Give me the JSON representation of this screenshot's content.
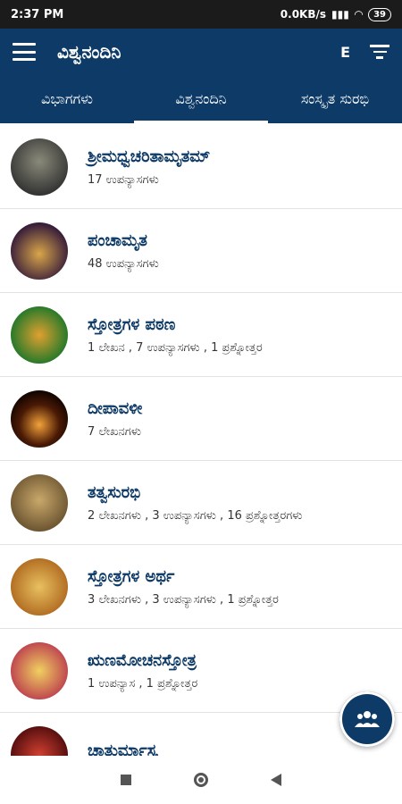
{
  "status": {
    "time": "2:37 PM",
    "speed": "0.0KB/s",
    "battery": "39"
  },
  "app": {
    "title": "ವಿಶ್ವನಂದಿನಿ",
    "lang": "E"
  },
  "tabs": [
    "ವಿಭಾಗಗಳು",
    "ವಿಶ್ವನಂದಿನಿ",
    "ಸಂಸ್ಕೃತ ಸುರಭಿ"
  ],
  "items": [
    {
      "title": "ಶ್ರೀಮಧ್ವಚರಿತಾಮೃತಮ್",
      "subtitle": "17 ಉಪನ್ಯಾಸಗಳು"
    },
    {
      "title": "ಪಂಚಾಮೃತ",
      "subtitle": "48 ಉಪನ್ಯಾಸಗಳು"
    },
    {
      "title": "ಸ್ತೋತ್ರಗಳ ಪಠಣ",
      "subtitle": "1 ಲೇಖನ , 7 ಉಪನ್ಯಾಸಗಳು , 1 ಪ್ರಶ್ನೋತ್ತರ"
    },
    {
      "title": "ದೀಪಾವಳೀ",
      "subtitle": "7 ಲೇಖನಗಳು"
    },
    {
      "title": "ತತ್ವಸುರಭಿ",
      "subtitle": "2 ಲೇಖನಗಳು , 3 ಉಪನ್ಯಾಸಗಳು , 16 ಪ್ರಶ್ನೋತ್ತರಗಳು"
    },
    {
      "title": "ಸ್ತೋತ್ರಗಳ ಅರ್ಥ",
      "subtitle": "3 ಲೇಖನಗಳು , 3 ಉಪನ್ಯಾಸಗಳು , 1 ಪ್ರಶ್ನೋತ್ತರ"
    },
    {
      "title": "ಋಣಮೋಚನಸ್ತೋತ್ರ",
      "subtitle": "1 ಉಪನ್ಯಾಸ , 1 ಪ್ರಶ್ನೋತ್ತರ"
    },
    {
      "title": "ಚಾತುರ್ಮಾಸ್ಯ",
      "subtitle": ""
    }
  ],
  "colors": {
    "primary": "#0d3a66"
  },
  "icons": {
    "menu": "hamburger-icon",
    "filter": "filter-icon",
    "fab": "group-icon"
  }
}
